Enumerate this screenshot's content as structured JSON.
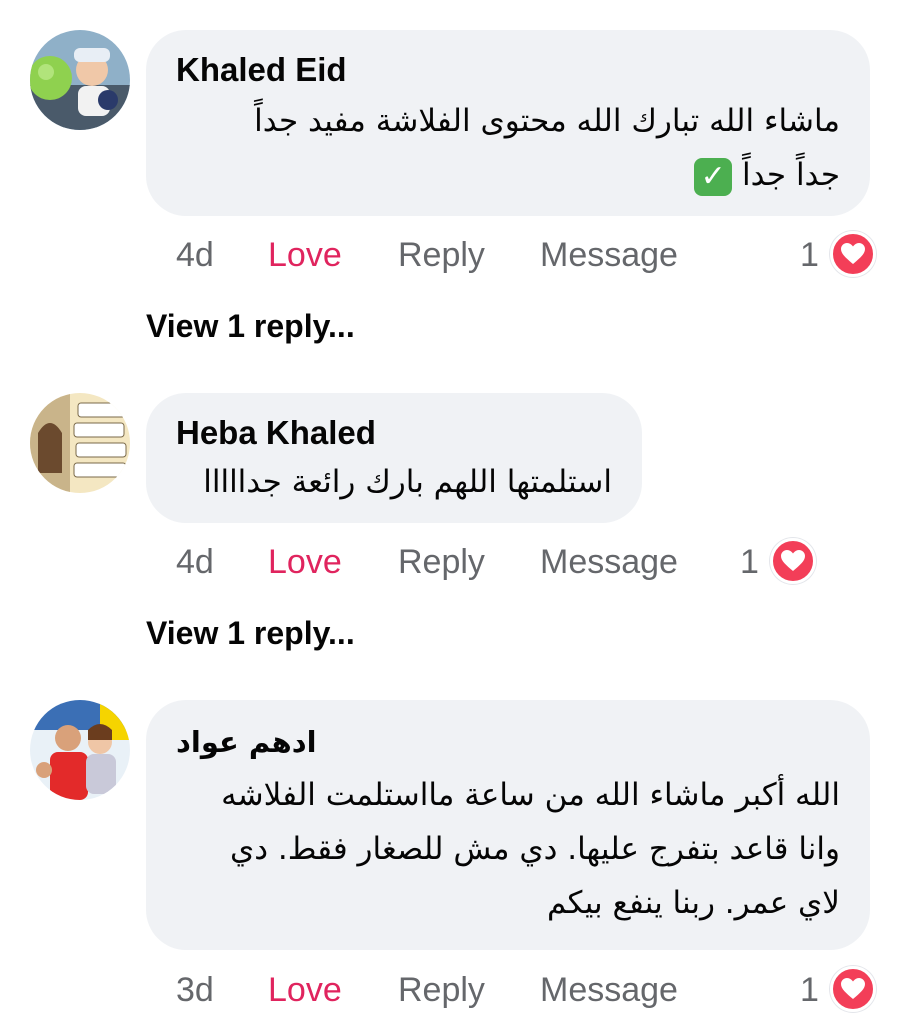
{
  "comments": [
    {
      "author": "Khaled Eid",
      "text_lines": [
        "ماشاء الله تبارك الله محتوى الفلاشة مفيد جداً",
        "جداً جداً"
      ],
      "has_check_emoji": true,
      "time": "4d",
      "love_label": "Love",
      "reply_label": "Reply",
      "message_label": "Message",
      "reaction_count": "1",
      "view_replies": "View 1 reply..."
    },
    {
      "author": "Heba Khaled",
      "text_lines": [
        "استلمتها اللهم بارك رائعة جدااااا"
      ],
      "time": "4d",
      "love_label": "Love",
      "reply_label": "Reply",
      "message_label": "Message",
      "reaction_count": "1",
      "view_replies": "View 1 reply..."
    },
    {
      "author": "ادهم عواد",
      "text_lines": [
        "الله أكبر ماشاء الله من ساعة مااستلمت الفلاشه",
        "وانا قاعد بتفرج عليها. دي مش للصغار فقط. دي",
        "لاي عمر. ربنا ينفع بيكم"
      ],
      "time": "3d",
      "love_label": "Love",
      "reply_label": "Reply",
      "message_label": "Message",
      "reaction_count": "1"
    }
  ],
  "colors": {
    "bubble": "#f0f2f5",
    "love": "#e0245e",
    "meta": "#65676b",
    "heart": "#f33e58"
  },
  "icons": {
    "check": "white-check-mark-emoji",
    "reaction": "heart-reaction-icon"
  }
}
